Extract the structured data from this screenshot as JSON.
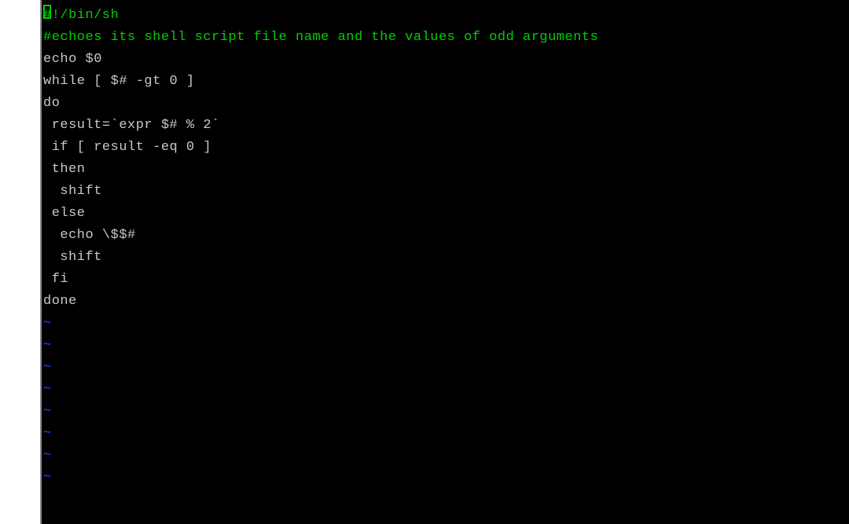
{
  "editor": {
    "lines": {
      "shebang_prefix": "#",
      "shebang_rest": "!/bin/sh",
      "comment": "#echoes its shell script file name and the values of odd arguments",
      "blank1": "",
      "l4": "echo $0",
      "l5": "while [ $# -gt 0 ]",
      "l6": "do",
      "l7": " result=`expr $# % 2`",
      "l8": " if [ result -eq 0 ]",
      "l9": " then",
      "l10": "  shift",
      "l11": " else",
      "l12": "  echo \\$$#",
      "l13": "  shift",
      "l14": " fi",
      "l15": "done"
    },
    "tilde": "~",
    "empty_line_count": 8
  }
}
